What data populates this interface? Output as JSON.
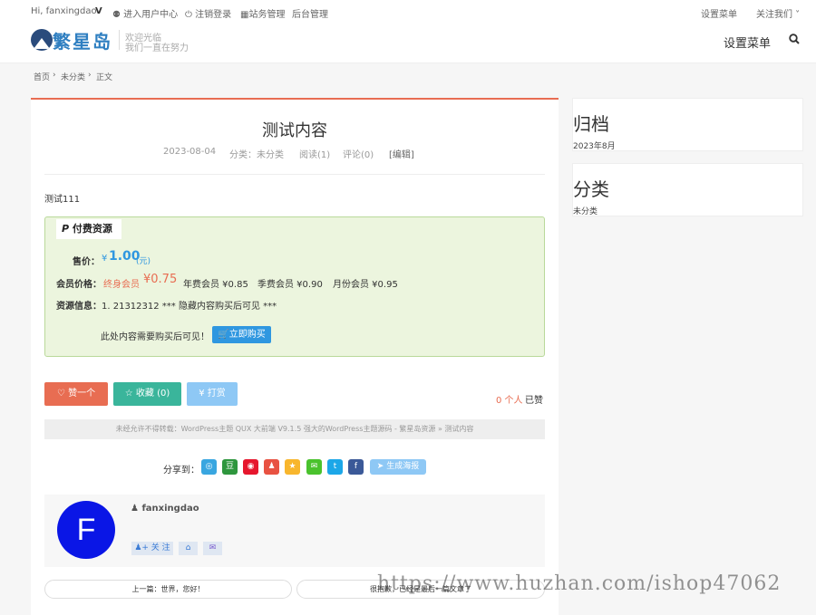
{
  "topbar": {
    "greeting": "Hi, fanxingdao",
    "vip_badge": "V",
    "user_center": "进入用户中心",
    "logout": "注销登录",
    "site_manage": "站务管理",
    "admin": "后台管理",
    "set_menu_small": "设置菜单",
    "follow_us": "关注我们"
  },
  "header": {
    "logo_text": "繁星岛",
    "slogan_1": "欢迎光临",
    "slogan_2": "我们一直在努力",
    "menu": "设置菜单"
  },
  "breadcrumb": [
    "首页",
    "未分类",
    "正文"
  ],
  "post": {
    "title": "测试内容",
    "date": "2023-08-04",
    "category": "分类：未分类",
    "views": "阅读(1)",
    "comments": "评论(0)",
    "edit": "[编辑]",
    "body": "测试111"
  },
  "pay": {
    "tag": "付费资源",
    "price_label": "售价：",
    "price_sign": "¥",
    "price": "1.00",
    "price_unit": "(元)",
    "member_label": "会员价格：",
    "lifetime": "终身会员",
    "lifetime_price": "¥0.75",
    "year": "年费会员 ¥0.85",
    "season": "季费会员 ¥0.90",
    "month": "月份会员 ¥0.95",
    "info_label": "资源信息：",
    "info_value": "1. 21312312  *** 隐藏内容购买后可见 ***",
    "notice": "此处内容需要购买后可见！",
    "buy_button": "立即购买"
  },
  "actions": {
    "like": "赞一个",
    "favorite": "收藏 (0)",
    "reward": "¥ 打赏",
    "liked_count": "0 个人",
    "liked_suffix": "已赞"
  },
  "copyright": "未经允许不得转载：WordPress主题 QUX 大前端 V9.1.5 强大的WordPress主题源码 - 繁星岛资源 » 测试内容",
  "share": {
    "label": "分享到：",
    "poster": "生成海报",
    "colors": [
      "#39a6e0",
      "#2e963d",
      "#e6162d",
      "#e85242",
      "#f8b62d",
      "#4ac22d",
      "#1ca7e8",
      "#3b5998"
    ]
  },
  "author": {
    "avatar_letter": "F",
    "name": "fanxingdao",
    "follow": "关 注"
  },
  "pager": {
    "prev": "上一篇：世界，您好！",
    "next": "很抱歉，已经是最后一篇文章了"
  },
  "sidebar": {
    "archive_title": "归档",
    "archive_item": "2023年8月",
    "category_title": "分类",
    "category_item": "未分类"
  },
  "watermark": "https://www.huzhan.com/ishop47062"
}
